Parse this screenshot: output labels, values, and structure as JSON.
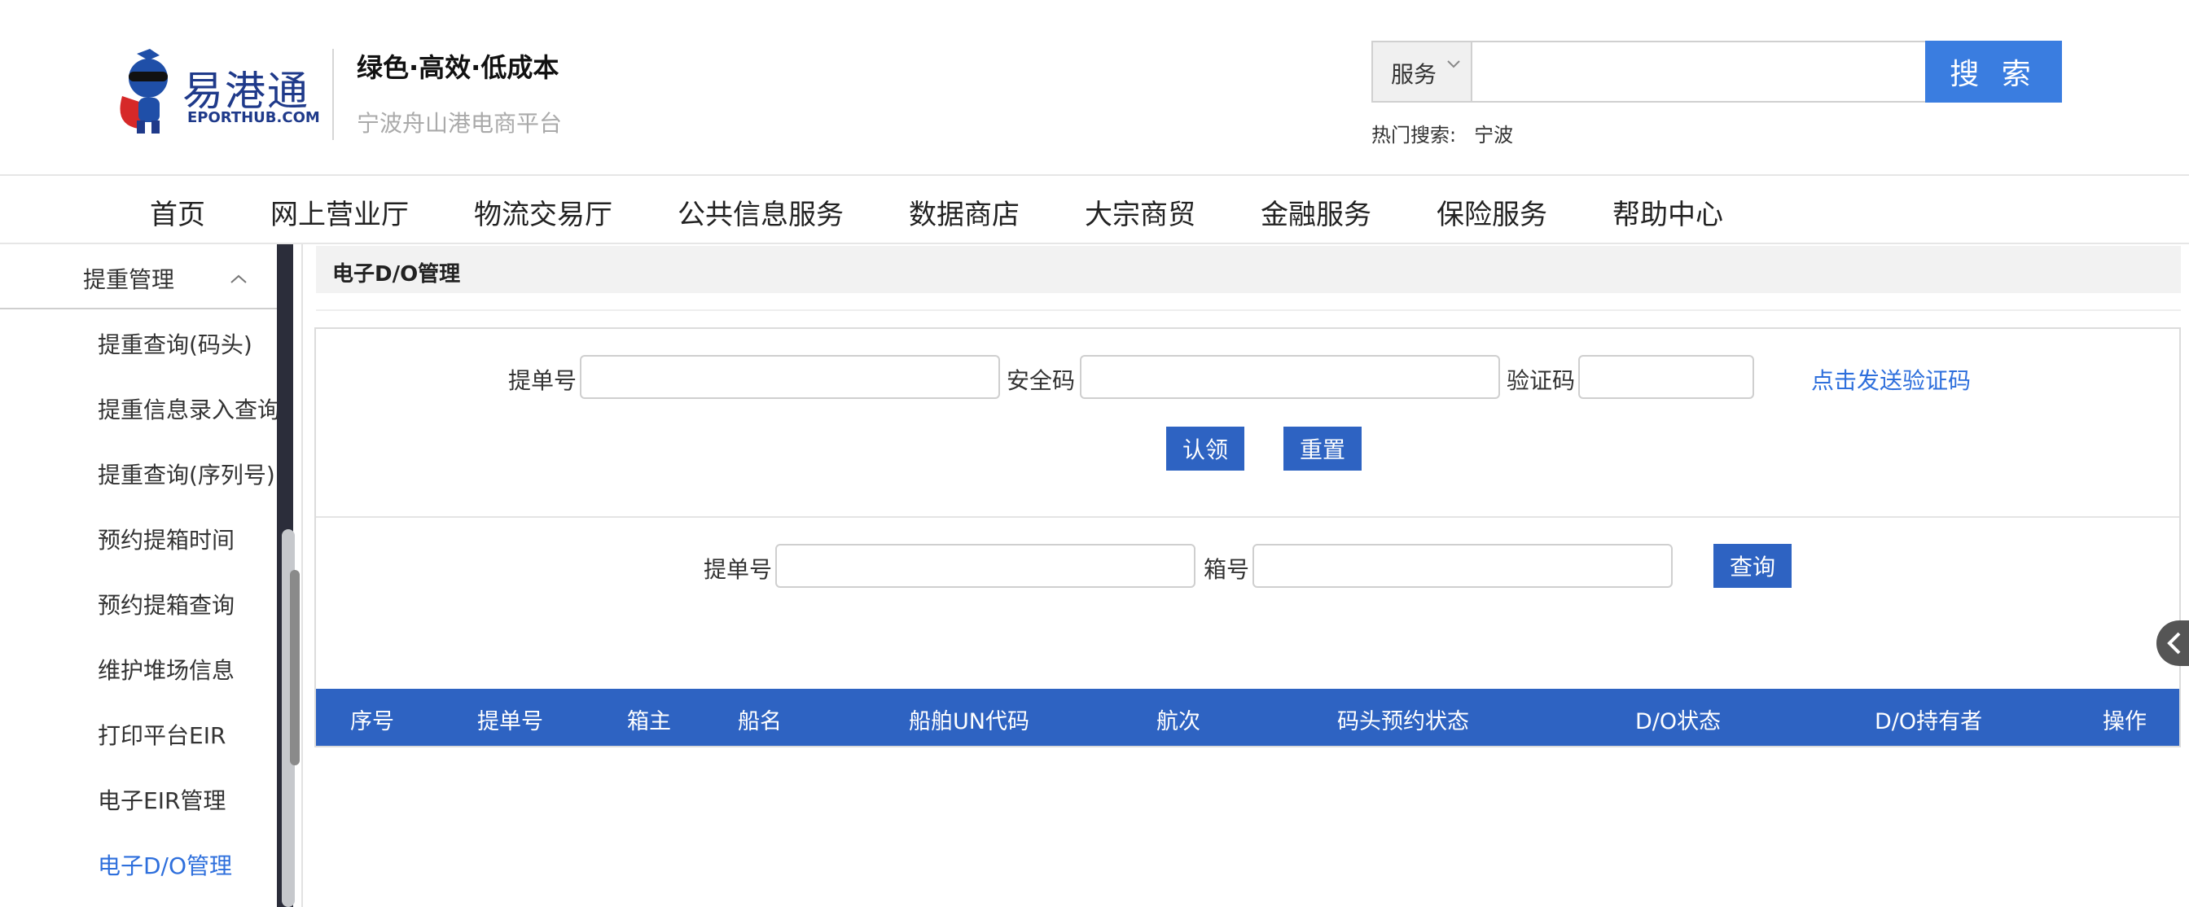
{
  "header": {
    "logo_text": "易港通",
    "logo_sub": "EPORTHUB.COM",
    "slogan": "绿色·高效·低成本",
    "platform": "宁波舟山港电商平台"
  },
  "search": {
    "select_value": "服务",
    "input_value": "",
    "button_label": "搜 索",
    "hot_label": "热门搜索:",
    "hot_items": [
      "宁波"
    ]
  },
  "nav": {
    "items": [
      "首页",
      "网上营业厅",
      "物流交易厅",
      "公共信息服务",
      "数据商店",
      "大宗商贸",
      "金融服务",
      "保险服务",
      "帮助中心"
    ]
  },
  "sidebar": {
    "group_title": "提重管理",
    "items": [
      {
        "label": "提重查询(码头)"
      },
      {
        "label": "提重信息录入查询"
      },
      {
        "label": "提重查询(序列号)"
      },
      {
        "label": "预约提箱时间"
      },
      {
        "label": "预约提箱查询"
      },
      {
        "label": "维护堆场信息"
      },
      {
        "label": "打印平台EIR"
      },
      {
        "label": "电子EIR管理"
      },
      {
        "label": "电子D/O管理"
      }
    ]
  },
  "main": {
    "breadcrumb": "电子D/O管理",
    "claim_form": {
      "bill_label": "提单号",
      "bill_value": "",
      "security_label": "安全码",
      "security_value": "",
      "verify_label": "验证码",
      "verify_value": "",
      "send_link": "点击发送验证码",
      "claim_button": "认领",
      "reset_button": "重置"
    },
    "query_form": {
      "bill_label": "提单号",
      "bill_value": "",
      "box_label": "箱号",
      "box_value": "",
      "query_button": "查询"
    },
    "table": {
      "columns": [
        "序号",
        "提单号",
        "箱主",
        "船名",
        "船舶UN代码",
        "航次",
        "码头预约状态",
        "D/O状态",
        "D/O持有者",
        "操作"
      ],
      "rows": []
    }
  },
  "colors": {
    "accent": "#2e63c2",
    "search_button": "#3a7de0",
    "link": "#2e6fdc",
    "active_sidebar": "#2e6fdc"
  }
}
